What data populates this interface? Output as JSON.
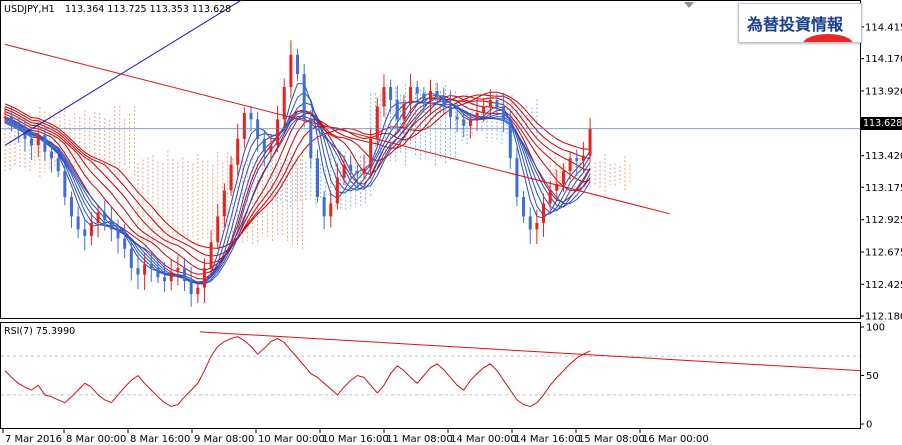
{
  "header": {
    "symbol": "USDJPY,H1",
    "ohlc": "113.364 113.725 113.353 113.628"
  },
  "logo": {
    "text": "為替投資情報"
  },
  "colors": {
    "bull_candle": "#e8231e",
    "bear_candle": "#3c6fd6",
    "ribbon_long": "#cc0000",
    "ribbon_short": "#2a4fc2",
    "cloud_red": "#f0a080",
    "cloud_blue": "#80b8e8",
    "trendline_blue": "#1010c0",
    "trendline_red": "#e01010",
    "rsi_line": "#d01010"
  },
  "chart_data": [
    {
      "type": "candlestick",
      "title": "USDJPY,H1",
      "ylim": [
        112.18,
        114.6
      ],
      "y_ticks": [
        "114.415",
        "114.170",
        "113.920",
        "113.670",
        "113.420",
        "113.175",
        "112.925",
        "112.675",
        "112.425",
        "112.180"
      ],
      "x_ticks": [
        "7 Mar 2016",
        "8 Mar 00:00",
        "8 Mar 16:00",
        "9 Mar 08:00",
        "10 Mar 00:00",
        "10 Mar 16:00",
        "11 Mar 08:00",
        "14 Mar 00:00",
        "14 Mar 16:00",
        "15 Mar 08:00",
        "16 Mar 00:00"
      ],
      "current_price": "113.628",
      "close_series": [
        113.72,
        113.68,
        113.62,
        113.55,
        113.5,
        113.58,
        113.45,
        113.4,
        113.3,
        113.1,
        112.95,
        112.85,
        112.8,
        112.9,
        112.98,
        112.92,
        112.85,
        112.78,
        112.7,
        112.55,
        112.5,
        112.58,
        112.55,
        112.48,
        112.45,
        112.52,
        112.55,
        112.45,
        112.35,
        112.4,
        112.55,
        112.75,
        112.95,
        113.15,
        113.35,
        113.55,
        113.75,
        113.7,
        113.55,
        113.45,
        113.5,
        113.7,
        113.95,
        114.2,
        114.05,
        113.7,
        113.4,
        113.1,
        112.95,
        113.05,
        113.25,
        113.35,
        113.3,
        113.28,
        113.32,
        113.55,
        113.8,
        113.95,
        113.85,
        113.7,
        113.82,
        113.95,
        113.9,
        113.85,
        113.92,
        113.88,
        113.8,
        113.72,
        113.7,
        113.65,
        113.7,
        113.75,
        113.8,
        113.85,
        113.8,
        113.7,
        113.4,
        113.1,
        112.95,
        112.85,
        112.9,
        113.05,
        113.15,
        113.2,
        113.3,
        113.4,
        113.38,
        113.42,
        113.63
      ],
      "ribbons": {
        "long": {
          "count": 6,
          "start": 113.65,
          "trough": 112.95,
          "mid": 113.35,
          "high": 113.72,
          "end": 113.32
        },
        "short": {
          "count": 6,
          "start": 113.7,
          "trough": 112.7,
          "mid": 113.3,
          "high": 113.85,
          "end": 113.4
        }
      },
      "trendlines": [
        {
          "name": "blue",
          "from": [
            0,
            113.5
          ],
          "to": [
            38,
            114.7
          ]
        },
        {
          "name": "red",
          "from": [
            0,
            114.28
          ],
          "to": [
            100,
            112.97
          ]
        }
      ],
      "hline": 113.628,
      "cloud": [
        {
          "from": 0,
          "to": 20,
          "top": 113.75,
          "bottom": 113.3,
          "color": "red"
        },
        {
          "from": 20,
          "to": 45,
          "top": 113.4,
          "bottom": 112.75,
          "color": "red"
        },
        {
          "from": 40,
          "to": 55,
          "top": 113.4,
          "bottom": 113.05,
          "color": "blue"
        },
        {
          "from": 55,
          "to": 68,
          "top": 113.92,
          "bottom": 113.4,
          "color": "blue"
        },
        {
          "from": 68,
          "to": 80,
          "top": 113.85,
          "bottom": 113.55,
          "color": "blue"
        },
        {
          "from": 82,
          "to": 94,
          "top": 113.4,
          "bottom": 113.15,
          "color": "red"
        }
      ]
    },
    {
      "type": "line",
      "title": "RSI(7) 75.3990",
      "ylim": [
        0,
        100
      ],
      "y_ticks": [
        "100",
        "50",
        "0"
      ],
      "levels": [
        70,
        30
      ],
      "values": [
        55,
        48,
        42,
        38,
        35,
        40,
        30,
        28,
        25,
        22,
        28,
        35,
        42,
        38,
        30,
        25,
        22,
        30,
        38,
        45,
        50,
        42,
        35,
        28,
        22,
        18,
        20,
        28,
        35,
        42,
        55,
        70,
        80,
        85,
        88,
        90,
        86,
        80,
        72,
        78,
        85,
        88,
        84,
        76,
        68,
        60,
        52,
        48,
        42,
        36,
        30,
        38,
        45,
        50,
        48,
        40,
        32,
        40,
        52,
        60,
        55,
        48,
        42,
        50,
        58,
        62,
        56,
        48,
        40,
        35,
        45,
        52,
        58,
        62,
        55,
        45,
        35,
        25,
        20,
        18,
        22,
        30,
        40,
        48,
        55,
        62,
        68,
        72,
        75.4
      ],
      "trendline": {
        "from": [
          0,
          95
        ],
        "to": [
          100,
          55
        ]
      }
    }
  ]
}
